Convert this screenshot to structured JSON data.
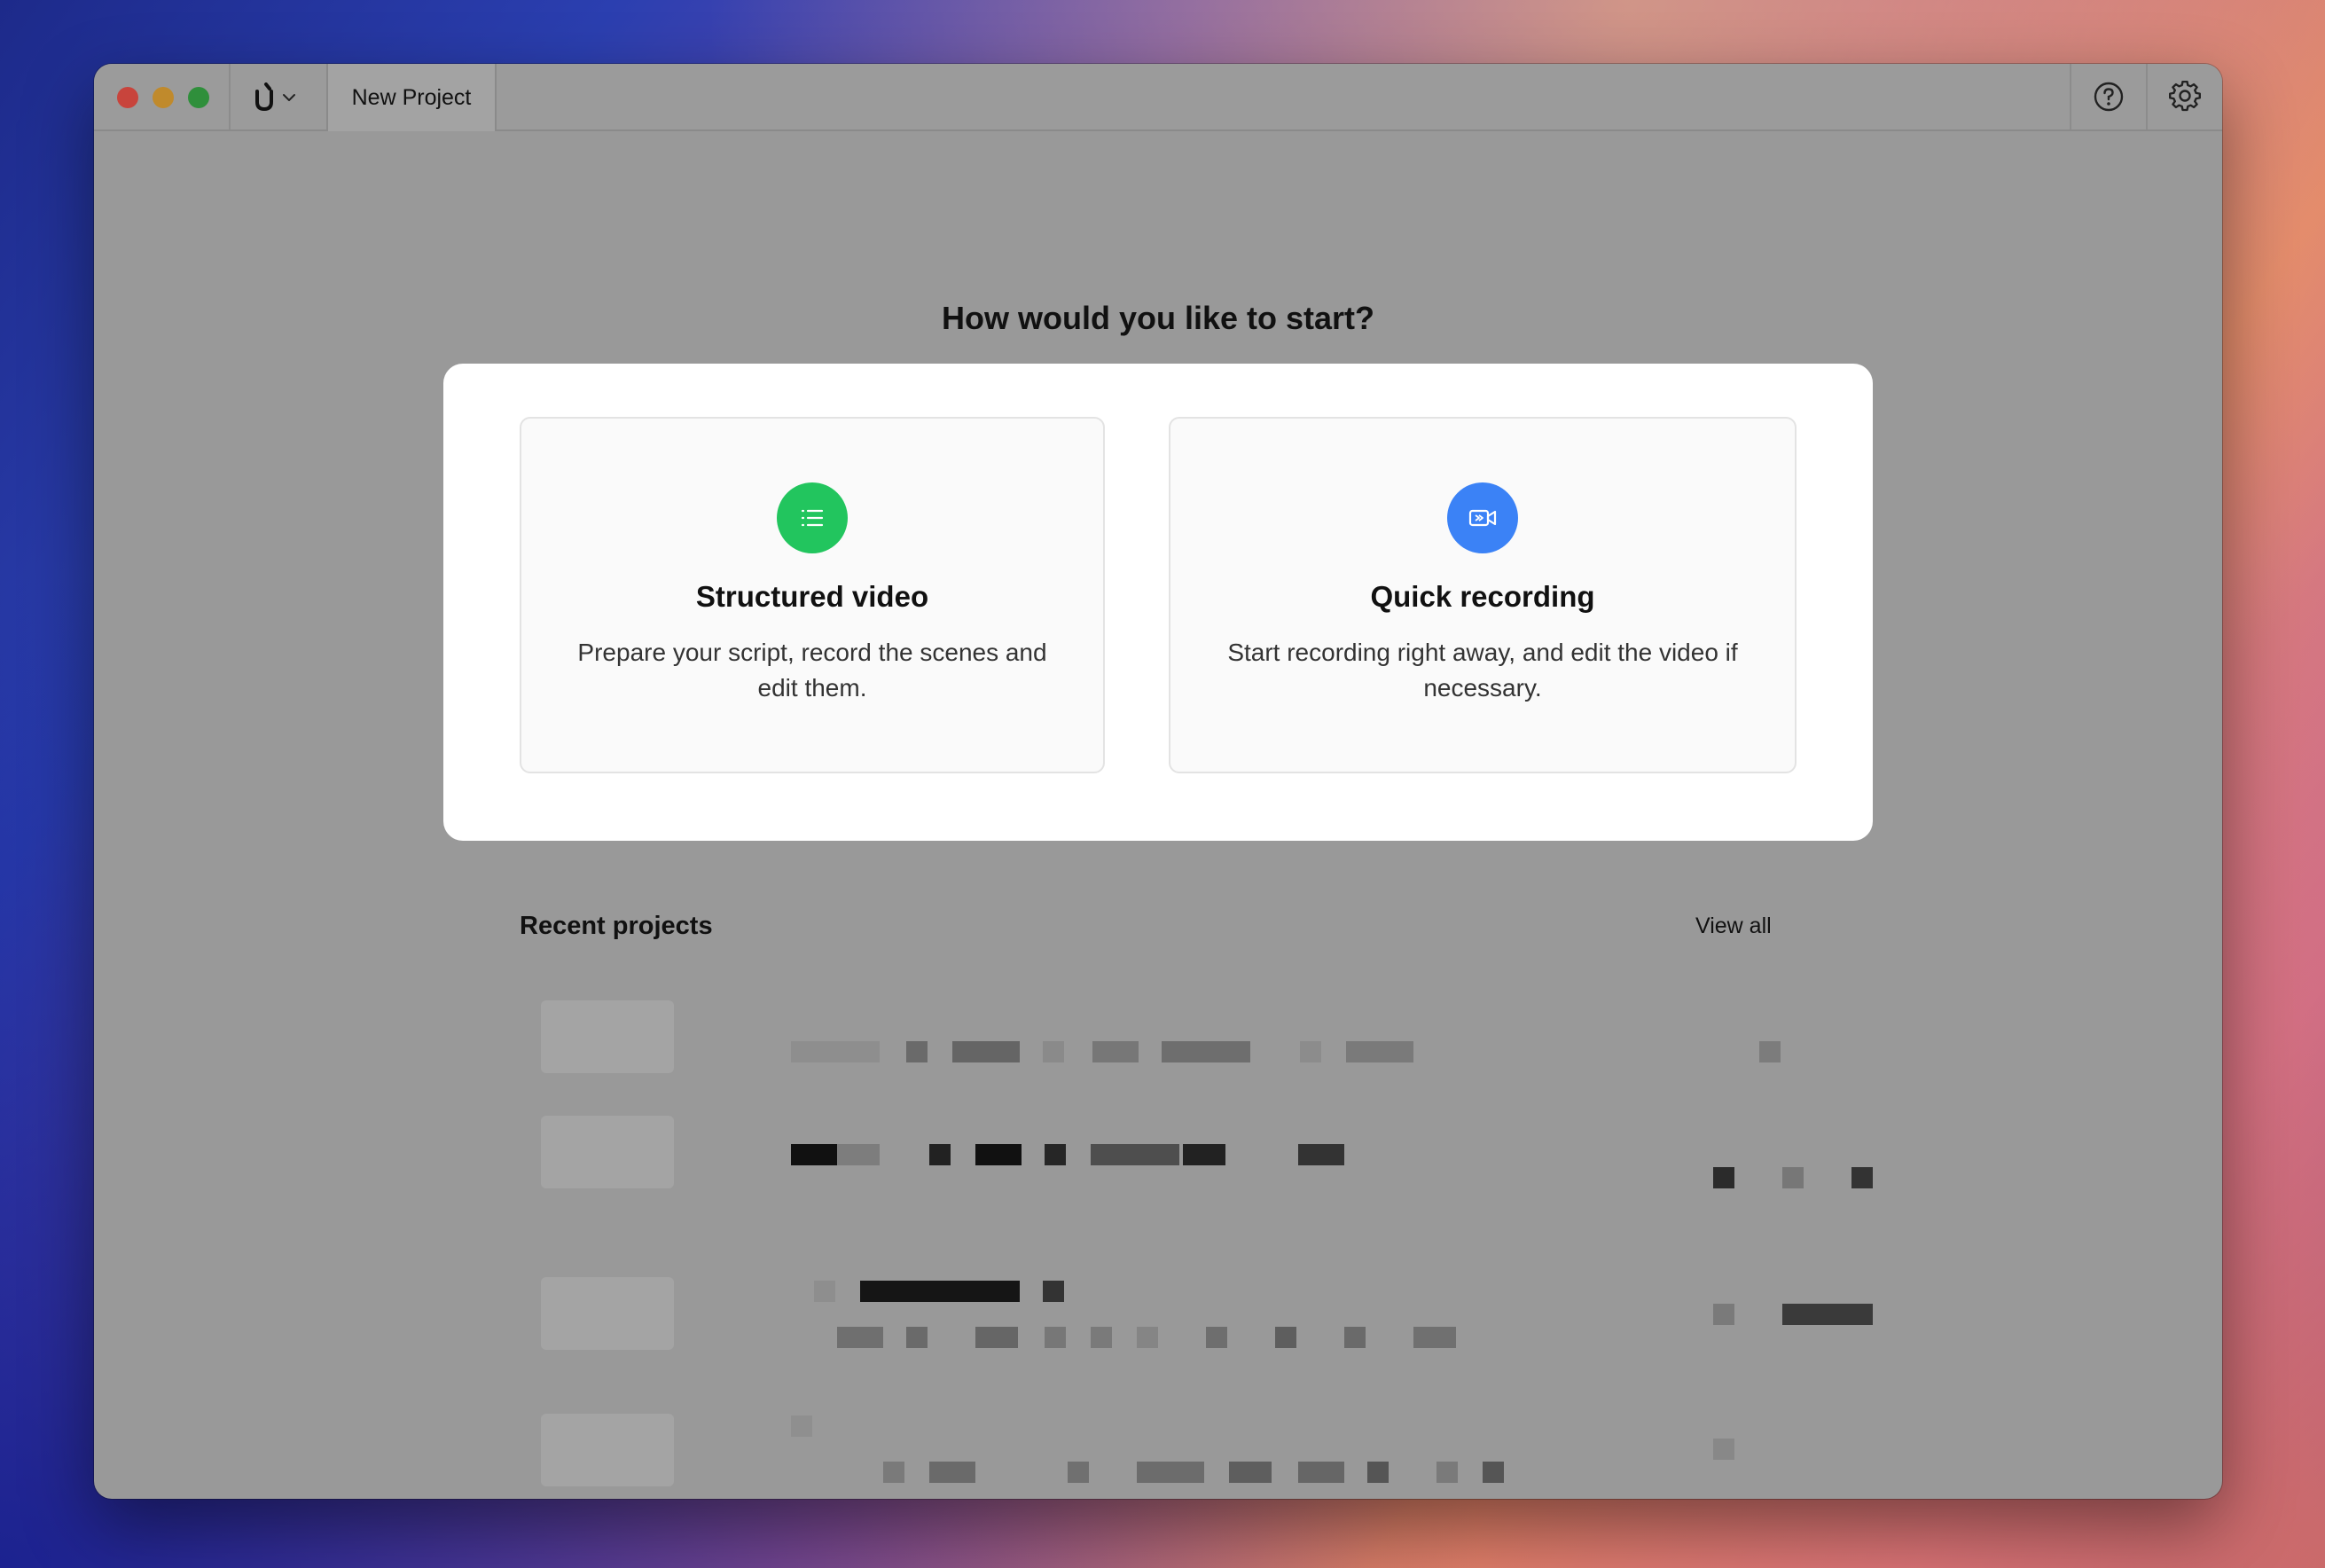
{
  "window": {
    "tab_title": "New Project"
  },
  "titlebar": {
    "app_logo_glyph": "Ú",
    "chevron_glyph": "⌄"
  },
  "main": {
    "heading": "How would you like to start?",
    "options": [
      {
        "title": "Structured video",
        "description": "Prepare your script, record the scenes and edit them.",
        "icon": "list-icon",
        "icon_color": "#22c55e"
      },
      {
        "title": "Quick recording",
        "description": "Start recording right away, and edit the video if necessary.",
        "icon": "video-camera-icon",
        "icon_color": "#3b82f6"
      }
    ]
  },
  "recent": {
    "title": "Recent projects",
    "view_all_label": "View all"
  },
  "colors": {
    "structured_accent": "#22c55e",
    "quick_accent": "#3b82f6",
    "overlay": "#999999"
  }
}
